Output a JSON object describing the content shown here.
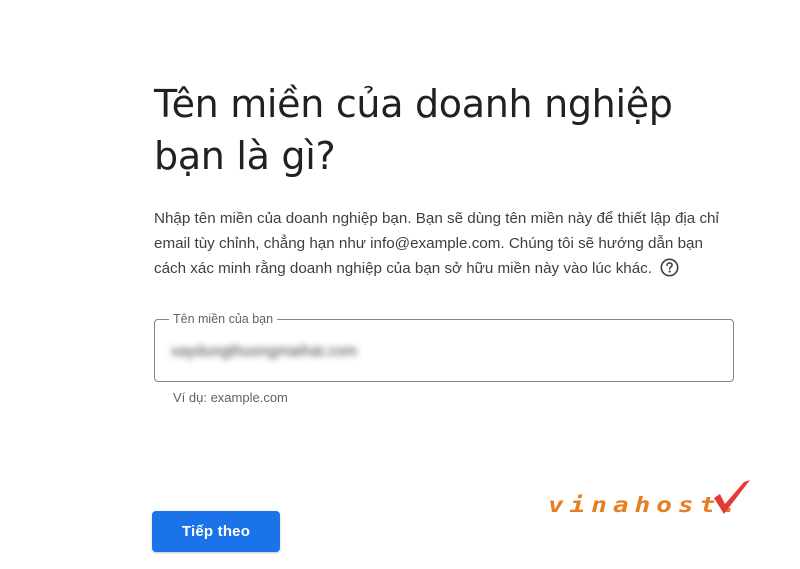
{
  "heading": "Tên miền của doanh nghiệp bạn là gì?",
  "description": "Nhập tên miền của doanh nghiệp bạn. Bạn sẽ dùng tên miền này để thiết lập địa chỉ email tùy chỉnh, chẳng hạn như info@example.com. Chúng tôi sẽ hướng dẫn bạn cách xác minh rằng doanh nghiệp của bạn sở hữu miền này vào lúc khác.",
  "help_icon": "help-circle-icon",
  "domain_field": {
    "label": "Tên miền của bạn",
    "value": "xaydungthuongmaihat.com",
    "hint": "Ví dụ: example.com"
  },
  "next_button": "Tiếp theo",
  "logo": {
    "text": "vinahost.",
    "icon": "red-checkmark-icon"
  },
  "colors": {
    "primary_button": "#1a73e8",
    "logo_orange": "#e67e22",
    "logo_red": "#e53935",
    "field_border": "#80868b"
  }
}
